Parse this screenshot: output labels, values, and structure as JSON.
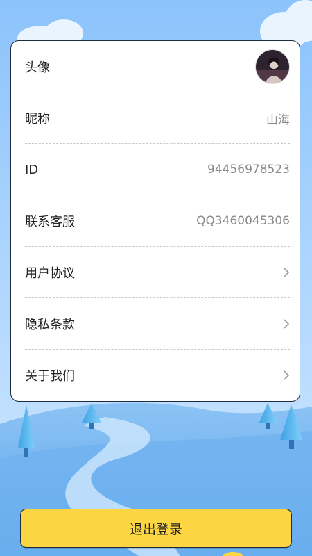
{
  "profile": {
    "avatar_label": "头像",
    "avatar_icon": "profile-photo",
    "nickname_label": "昵称",
    "nickname_value": "山海",
    "id_label": "ID",
    "id_value": "94456978523",
    "support_label": "联系客服",
    "support_value": "QQ3460045306",
    "agreement_label": "用户协议",
    "privacy_label": "隐私条款",
    "about_label": "关于我们",
    "chevron_icon": "chevron-right-icon"
  },
  "footer": {
    "logout_label": "退出登录"
  },
  "colors": {
    "sky_top": "#8bc3fb",
    "sky_bottom": "#cfe7ff",
    "hill": "#5aa7ef",
    "card_border": "#1c2c3c",
    "logout_bg": "#fbd642",
    "value_text": "#8a8a8a"
  }
}
